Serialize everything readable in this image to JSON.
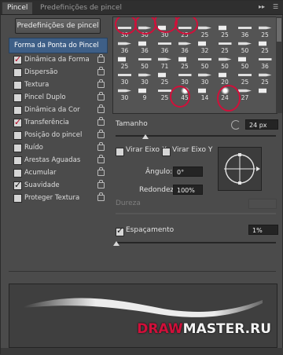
{
  "tabs": [
    "Pincel",
    "Predefinições de pincel"
  ],
  "tab_controls": {
    "collapse": "▸▸",
    "menu": "☰"
  },
  "preset_button": "Predefinições de pincel",
  "left_menu": [
    {
      "label": "Forma da Ponta do Pincel",
      "checked": false,
      "lock": false,
      "head": true
    },
    {
      "label": "Dinâmica da Forma",
      "checked": true,
      "lock": true
    },
    {
      "label": "Dispersão",
      "checked": false,
      "lock": true
    },
    {
      "label": "Textura",
      "checked": false,
      "lock": true
    },
    {
      "label": "Pincel Duplo",
      "checked": false,
      "lock": true
    },
    {
      "label": "Dinâmica da Cor",
      "checked": false,
      "lock": true
    },
    {
      "label": "Transferência",
      "checked": true,
      "lock": true
    },
    {
      "label": "Posição do pincel",
      "checked": false,
      "lock": true
    },
    {
      "label": "Ruído",
      "checked": false,
      "lock": true
    },
    {
      "label": "Arestas Aguadas",
      "checked": false,
      "lock": true
    },
    {
      "label": "Acumular",
      "checked": false,
      "lock": true
    },
    {
      "label": "Suavidade",
      "checked": true,
      "lock": true
    },
    {
      "label": "Proteger Textura",
      "checked": false,
      "lock": true
    }
  ],
  "brush_grid": {
    "rows": [
      [
        "",
        "",
        "",
        "",
        "",
        "",
        "",
        ""
      ],
      [
        "30",
        "30",
        "30",
        "25",
        "25",
        "25",
        "36",
        "25"
      ],
      [
        "36",
        "36",
        "36",
        "36",
        "32",
        "25",
        "50",
        "25"
      ],
      [
        "25",
        "50",
        "71",
        "25",
        "50",
        "50",
        "50",
        "36"
      ],
      [
        "30",
        "30",
        "25",
        "30",
        "30",
        "20",
        "25",
        "25"
      ],
      [
        "30",
        "9",
        "25",
        "45",
        "14",
        "24",
        "27",
        ""
      ]
    ]
  },
  "size": {
    "label": "Tamanho",
    "value": "24 px"
  },
  "flip_x": {
    "label": "Virar Eixo X",
    "checked": false
  },
  "flip_y": {
    "label": "Virar Eixo Y",
    "checked": false
  },
  "angle": {
    "label": "Ângulo:",
    "value": "0°"
  },
  "roundness": {
    "label": "Redondez:",
    "value": "100%"
  },
  "hardness": {
    "label": "Dureza"
  },
  "spacing": {
    "label": "Espaçamento",
    "value": "1%",
    "checked": true
  },
  "watermark": "DRAWMASTER.RU",
  "colors": {
    "accent": "#3e5f87",
    "highlight": "#d0103a"
  }
}
